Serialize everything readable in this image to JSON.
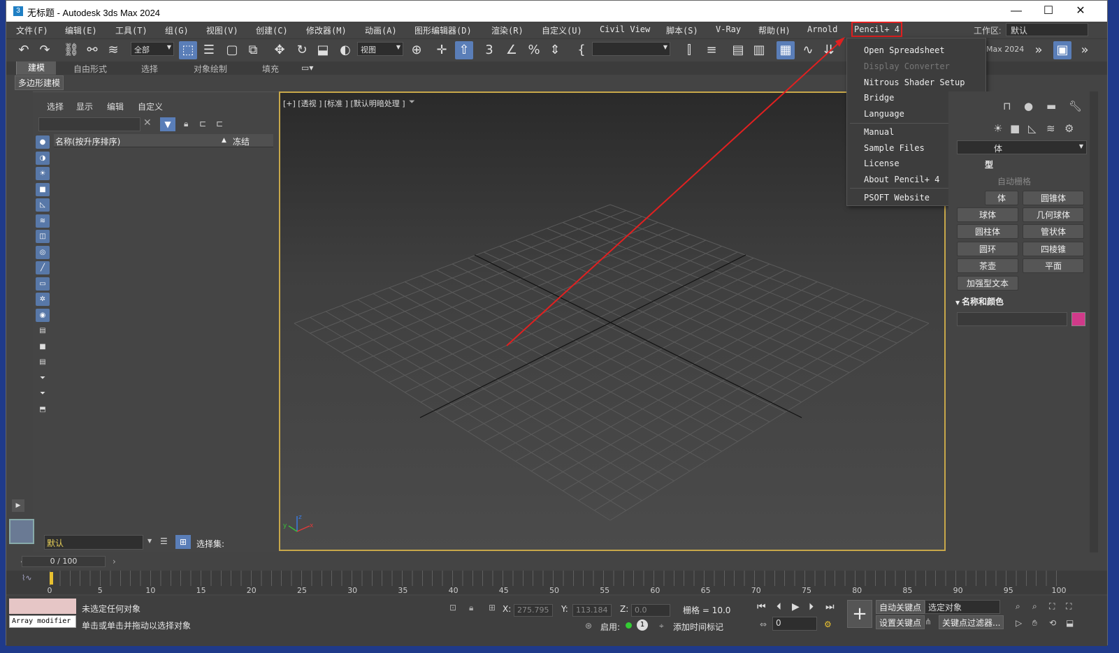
{
  "window": {
    "title": "无标题 - Autodesk 3ds Max 2024",
    "app_icon": "3",
    "controls": {
      "min": "—",
      "max": "☐",
      "close": "✕"
    }
  },
  "menubar": {
    "items": [
      "文件(F)",
      "编辑(E)",
      "工具(T)",
      "组(G)",
      "视图(V)",
      "创建(C)",
      "修改器(M)",
      "动画(A)",
      "图形编辑器(D)",
      "渲染(R)",
      "自定义(U)",
      "Civil View",
      "脚本(S)",
      "V-Ray",
      "帮助(H)",
      "Arnold",
      "Pencil+ 4"
    ],
    "workspace_label": "工作区:",
    "workspace_value": "默认"
  },
  "toolbar": {
    "selection_filter": "全部",
    "ref_coord": "视图",
    "named_set": "",
    "version_label": "Max 2024"
  },
  "ribbon": {
    "tabs": [
      "建模",
      "自由形式",
      "选择",
      "对象绘制",
      "填充"
    ],
    "active": "建模",
    "sub": "多边形建模"
  },
  "scene_explorer": {
    "tabs": [
      "选择",
      "显示",
      "编辑",
      "自定义"
    ],
    "col_name": "名称(按升序排序)",
    "col_freeze": "冻结",
    "sort_arrow": "▲",
    "layer": "默认",
    "selection_set_label": "选择集:"
  },
  "viewport": {
    "label": "[+] [透视 ] [标准 ] [默认明暗处理 ]",
    "axis_x": "x",
    "axis_z": "z",
    "axis_y": "y"
  },
  "pencil_menu": {
    "items": [
      {
        "label": "Open Spreadsheet",
        "disabled": false
      },
      {
        "label": "Display Converter",
        "disabled": true
      },
      {
        "label": "Nitrous Shader Setup",
        "disabled": false
      },
      {
        "label": "Bridge",
        "submenu": true
      },
      {
        "label": "Language",
        "submenu": true
      },
      {
        "label": "Manual"
      },
      {
        "label": "Sample Files"
      },
      {
        "label": "License"
      },
      {
        "label": "About Pencil+ 4"
      },
      {
        "label": "PSOFT Website"
      }
    ]
  },
  "command_panel": {
    "category": "体",
    "object_type_header": "型",
    "auto_grid": "自动栅格",
    "buttons": [
      "体",
      "圆锥体",
      "球体",
      "几何球体",
      "圆柱体",
      "管状体",
      "圆环",
      "四棱锥",
      "茶壶",
      "平面",
      "加强型文本"
    ],
    "name_color_header": "名称和颜色",
    "swatch_color": "#d13a8a"
  },
  "timeline": {
    "frame": "0 / 100",
    "ticks": [
      "0",
      "5",
      "10",
      "15",
      "20",
      "25",
      "30",
      "35",
      "40",
      "45",
      "50",
      "55",
      "60",
      "65",
      "70",
      "75",
      "80",
      "85",
      "90",
      "95",
      "100"
    ]
  },
  "status": {
    "maxscript": "Array modifier",
    "line1": "未选定任何对象",
    "line2": "单击或单击并拖动以选择对象",
    "x_label": "X:",
    "x": "275.795",
    "y_label": "Y:",
    "y": "113.184",
    "z_label": "Z:",
    "z": "0.0",
    "grid": "栅格 = 10.0",
    "enable": "启用:",
    "add_tag": "添加时间标记",
    "auto_key": "自动关键点",
    "set_key": "设置关键点",
    "selected": "选定对象",
    "key_filter": "关键点过滤器...",
    "frame_field": "0"
  },
  "accent": {
    "highlight": "#e12020",
    "viewport_border": "#c8a84a",
    "active_blue": "#5a7eb8"
  }
}
